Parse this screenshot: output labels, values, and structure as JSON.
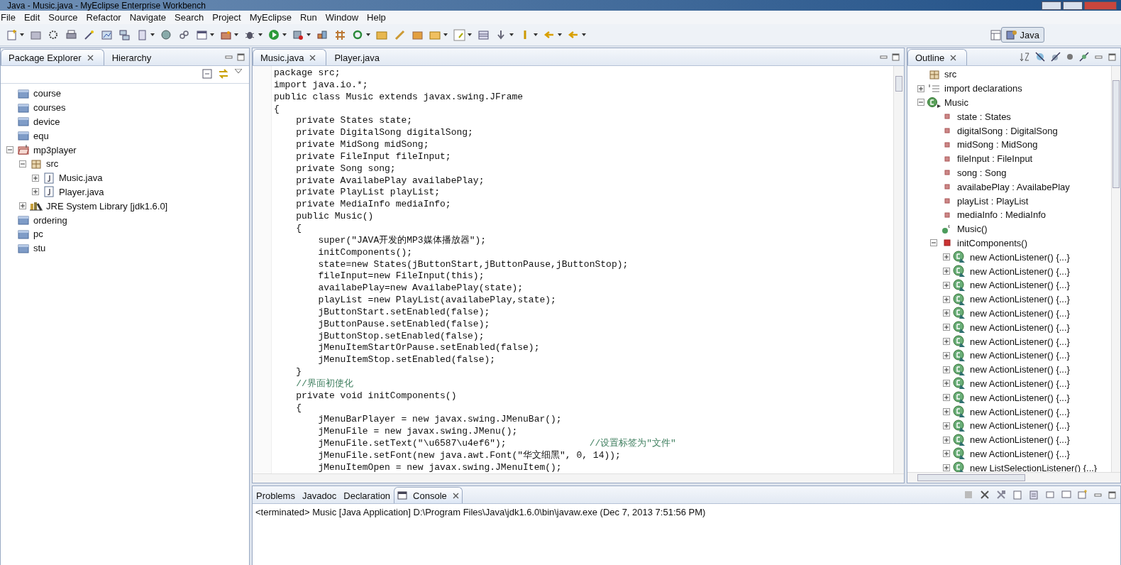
{
  "window": {
    "title": "Java - Music.java - MyEclipse Enterprise Workbench"
  },
  "menu": [
    "File",
    "Edit",
    "Source",
    "Refactor",
    "Navigate",
    "Search",
    "Project",
    "MyEclipse",
    "Run",
    "Window",
    "Help"
  ],
  "perspective": {
    "label": "Java",
    "selected": true
  },
  "package_explorer": {
    "tabs": [
      {
        "label": "Package Explorer",
        "selected": true
      },
      {
        "label": "Hierarchy",
        "selected": false
      }
    ],
    "items": [
      {
        "label": "course",
        "kind": "project"
      },
      {
        "label": "courses",
        "kind": "project"
      },
      {
        "label": "device",
        "kind": "project"
      },
      {
        "label": "equ",
        "kind": "project"
      },
      {
        "label": "mp3player",
        "kind": "openproject",
        "expanded": true,
        "children": [
          {
            "label": "src",
            "kind": "package",
            "expanded": true,
            "children": [
              {
                "label": "Music.java",
                "kind": "javafile",
                "expanded": false
              },
              {
                "label": "Player.java",
                "kind": "javafile",
                "expanded": false
              }
            ]
          },
          {
            "label": "JRE System Library [jdk1.6.0]",
            "kind": "library",
            "expanded": false
          }
        ]
      },
      {
        "label": "ordering",
        "kind": "project"
      },
      {
        "label": "pc",
        "kind": "project"
      },
      {
        "label": "stu",
        "kind": "project"
      }
    ]
  },
  "editor": {
    "tabs": [
      {
        "label": "Music.java",
        "selected": true
      },
      {
        "label": "Player.java",
        "selected": false
      }
    ],
    "lines": [
      {
        "code": "package src;"
      },
      {
        "code": "import java.io.*;"
      },
      {
        "code": "public class Music extends javax.swing.JFrame"
      },
      {
        "code": "{"
      },
      {
        "code": "    private States state;"
      },
      {
        "code": "    private DigitalSong digitalSong;"
      },
      {
        "code": "    private MidSong midSong;"
      },
      {
        "code": "    private FileInput fileInput;"
      },
      {
        "code": "    private Song song;"
      },
      {
        "code": "    private AvailabePlay availabePlay;"
      },
      {
        "code": "    private PlayList playList;"
      },
      {
        "code": "    private MediaInfo mediaInfo;"
      },
      {
        "code": "    public Music()"
      },
      {
        "code": "    {"
      },
      {
        "code": "        super(\"JAVA开发的MP3媒体播放器\");"
      },
      {
        "code": "        initComponents();"
      },
      {
        "code": "        state=new States(jButtonStart,jButtonPause,jButtonStop);"
      },
      {
        "code": "        fileInput=new FileInput(this);"
      },
      {
        "code": "        availabePlay=new AvailabePlay(state);"
      },
      {
        "code": "        playList =new PlayList(availabePlay,state);"
      },
      {
        "code": "        jButtonStart.setEnabled(false);"
      },
      {
        "code": "        jButtonPause.setEnabled(false);"
      },
      {
        "code": "        jButtonStop.setEnabled(false);"
      },
      {
        "code": "        jMenuItemStartOrPause.setEnabled(false);"
      },
      {
        "code": "        jMenuItemStop.setEnabled(false);"
      },
      {
        "code": "    }"
      },
      {
        "comment": "    //界面初使化"
      },
      {
        "code": "    private void initComponents()"
      },
      {
        "code": "    {"
      },
      {
        "code": "        jMenuBarPlayer = new javax.swing.JMenuBar();"
      },
      {
        "code": "        jMenuFile = new javax.swing.JMenu();"
      },
      {
        "code": "        jMenuFile.setText(\"\\u6587\\u4ef6\");               ",
        "comment": "//设置标签为\"文件\""
      },
      {
        "code": "        jMenuFile.setFont(new java.awt.Font(\"华文细黑\", 0, 14));"
      },
      {
        "code": "        jMenuItemOpen = new javax.swing.JMenuItem();"
      }
    ]
  },
  "outline": {
    "tab": {
      "label": "Outline",
      "selected": true
    },
    "items": [
      {
        "label": "src",
        "kind": "package"
      },
      {
        "label": "import declarations",
        "kind": "imports",
        "expanded": false
      },
      {
        "label": "Music",
        "kind": "class",
        "expanded": true,
        "children": [
          {
            "label": "state : States",
            "kind": "field"
          },
          {
            "label": "digitalSong : DigitalSong",
            "kind": "field"
          },
          {
            "label": "midSong : MidSong",
            "kind": "field"
          },
          {
            "label": "fileInput : FileInput",
            "kind": "field"
          },
          {
            "label": "song : Song",
            "kind": "field"
          },
          {
            "label": "availabePlay : AvailabePlay",
            "kind": "field"
          },
          {
            "label": "playList : PlayList",
            "kind": "field"
          },
          {
            "label": "mediaInfo : MediaInfo",
            "kind": "field"
          },
          {
            "label": "Music()",
            "kind": "constructor"
          },
          {
            "label": "initComponents()",
            "kind": "method",
            "expanded": true,
            "children": [
              {
                "label": "new ActionListener() {...}",
                "kind": "anonymous",
                "expanded": false
              },
              {
                "label": "new ActionListener() {...}",
                "kind": "anonymous",
                "expanded": false
              },
              {
                "label": "new ActionListener() {...}",
                "kind": "anonymous",
                "expanded": false
              },
              {
                "label": "new ActionListener() {...}",
                "kind": "anonymous",
                "expanded": false
              },
              {
                "label": "new ActionListener() {...}",
                "kind": "anonymous",
                "expanded": false
              },
              {
                "label": "new ActionListener() {...}",
                "kind": "anonymous",
                "expanded": false
              },
              {
                "label": "new ActionListener() {...}",
                "kind": "anonymous",
                "expanded": false
              },
              {
                "label": "new ActionListener() {...}",
                "kind": "anonymous",
                "expanded": false
              },
              {
                "label": "new ActionListener() {...}",
                "kind": "anonymous",
                "expanded": false
              },
              {
                "label": "new ActionListener() {...}",
                "kind": "anonymous",
                "expanded": false
              },
              {
                "label": "new ActionListener() {...}",
                "kind": "anonymous",
                "expanded": false
              },
              {
                "label": "new ActionListener() {...}",
                "kind": "anonymous",
                "expanded": false
              },
              {
                "label": "new ActionListener() {...}",
                "kind": "anonymous",
                "expanded": false
              },
              {
                "label": "new ActionListener() {...}",
                "kind": "anonymous",
                "expanded": false
              },
              {
                "label": "new ActionListener() {...}",
                "kind": "anonymous",
                "expanded": false
              },
              {
                "label": "new ListSelectionListener() {...}",
                "kind": "anonymous",
                "expanded": false
              }
            ]
          }
        ]
      }
    ]
  },
  "console": {
    "tabs": [
      {
        "label": "Problems",
        "selected": false
      },
      {
        "label": "Javadoc",
        "selected": false
      },
      {
        "label": "Declaration",
        "selected": false
      },
      {
        "label": "Console",
        "selected": true
      }
    ],
    "status": "<terminated> Music [Java Application] D:\\Program Files\\Java\\jdk1.6.0\\bin\\javaw.exe (Dec 7, 2013 7:51:56 PM)"
  }
}
